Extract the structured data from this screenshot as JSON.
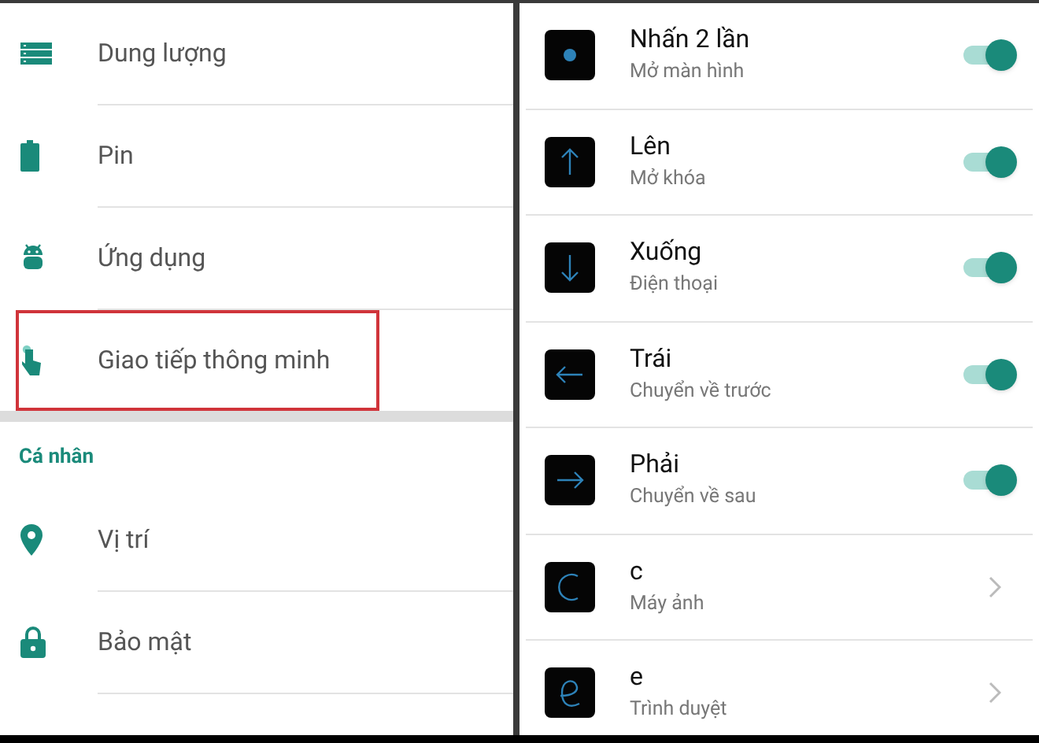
{
  "settings_panel": {
    "groups": [
      {
        "items": [
          {
            "label": "Dung lượng",
            "highlighted": false
          },
          {
            "label": "Pin",
            "highlighted": false
          },
          {
            "label": "Ứng dụng",
            "highlighted": false
          },
          {
            "label": "Giao tiếp thông minh",
            "highlighted": true
          }
        ]
      },
      {
        "header": "Cá nhân",
        "items": [
          {
            "label": "Vị trí",
            "highlighted": false
          },
          {
            "label": "Bảo mật",
            "highlighted": false
          }
        ]
      }
    ]
  },
  "gestures_panel": {
    "items": [
      {
        "title": "Nhấn 2 lần",
        "subtitle": "Mở màn hình",
        "kind": "toggle",
        "on": true
      },
      {
        "title": "Lên",
        "subtitle": "Mở khóa",
        "kind": "toggle",
        "on": true
      },
      {
        "title": "Xuống",
        "subtitle": "Điện thoại",
        "kind": "toggle",
        "on": true
      },
      {
        "title": "Trái",
        "subtitle": "Chuyển về trước",
        "kind": "toggle",
        "on": true
      },
      {
        "title": "Phải",
        "subtitle": "Chuyển về sau",
        "kind": "toggle",
        "on": true
      },
      {
        "title": "c",
        "subtitle": "Máy ảnh",
        "kind": "link"
      },
      {
        "title": "e",
        "subtitle": "Trình duyệt",
        "kind": "link"
      }
    ]
  }
}
